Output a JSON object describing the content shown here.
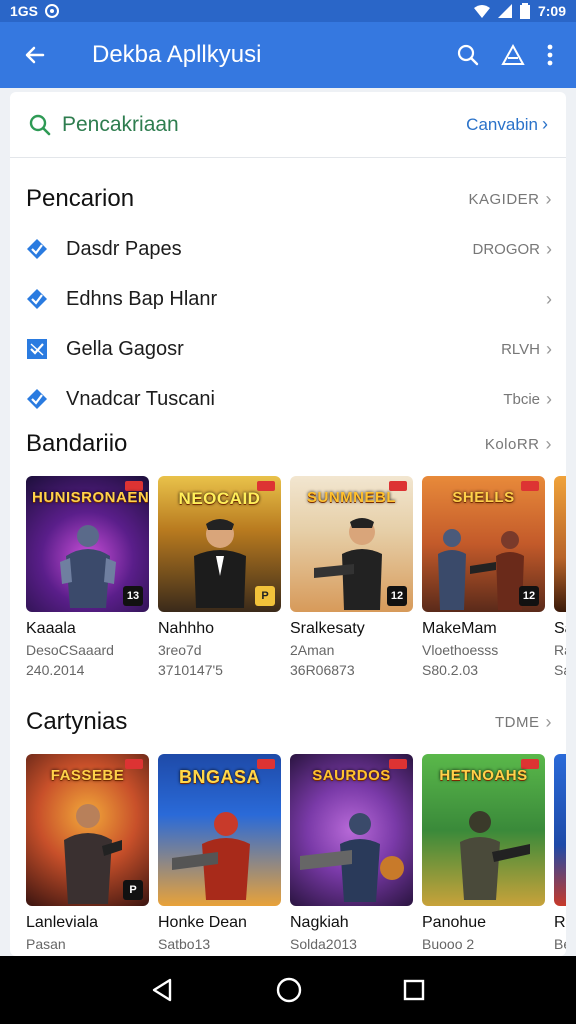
{
  "status_bar": {
    "left_text": "1GS",
    "time": "7:09"
  },
  "app_bar": {
    "title": "Dekba Apllkyusi"
  },
  "search": {
    "placeholder": "Pencakriaan",
    "link": "Canvabin"
  },
  "section1": {
    "title": "Pencarion",
    "more": "KAGIDER",
    "items": [
      {
        "label": "Dasdr Papes",
        "meta": "DROGOR"
      },
      {
        "label": "Edhns Bap Hlanr",
        "meta": ""
      },
      {
        "label": "Gella Gagosr",
        "meta": "RLVH"
      },
      {
        "label": "Vnadcar Tuscani",
        "meta": "Tbcie"
      }
    ]
  },
  "section2": {
    "title": "Bandariio",
    "more": "KoloRR",
    "games": [
      {
        "name": "Kaaala",
        "sub": "DesoCSaaard",
        "sub2": "240.2014",
        "thumb_text": "HUNISRONAENS",
        "badge": "13"
      },
      {
        "name": "Nahhho",
        "sub": "3reo7d",
        "sub2": "3710147'5",
        "thumb_text": "NEOCAID",
        "badge": "P"
      },
      {
        "name": "Sralkesaty",
        "sub": "2Aman",
        "sub2": "36R06873",
        "thumb_text": "SUNMNEBL",
        "badge": "12"
      },
      {
        "name": "MakeMam",
        "sub": "Vloethoesss",
        "sub2": "S80.2.03",
        "thumb_text": "SHELLS",
        "badge": "12"
      },
      {
        "name": "Sa",
        "sub": "Ra",
        "sub2": "SaJ",
        "thumb_text": "",
        "badge": ""
      }
    ]
  },
  "section3": {
    "title": "Cartynias",
    "more": "TDME",
    "games": [
      {
        "name": "Lanleviala",
        "sub": "Pasan",
        "thumb_text": "FASSEBE",
        "badge": "P"
      },
      {
        "name": "Honke Dean",
        "sub": "Satbo13",
        "thumb_text": "BNGASA",
        "badge": ""
      },
      {
        "name": "Nagkiah",
        "sub": "Solda2013",
        "thumb_text": "SAURDOS",
        "badge": ""
      },
      {
        "name": "Panohue",
        "sub": "Buooo 2",
        "thumb_text": "HETNOAHS",
        "badge": ""
      },
      {
        "name": "Rad",
        "sub": "Bel",
        "thumb_text": "",
        "badge": ""
      }
    ]
  },
  "colors": {
    "appbar": "#3578e0",
    "statusbar": "#2a66c8",
    "check": "#2a7be0",
    "search_text": "#2e7d4f",
    "link": "#2a72c9"
  }
}
